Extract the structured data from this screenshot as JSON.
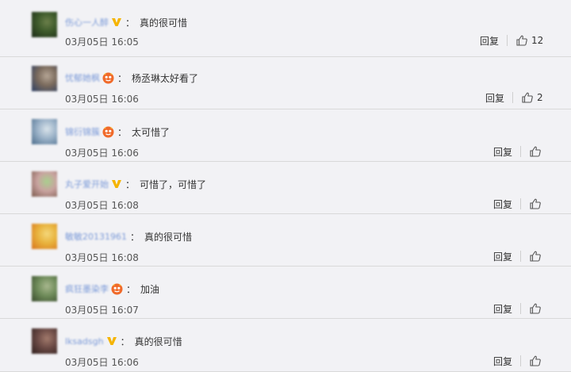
{
  "comments": [
    {
      "username": "伤心一人醉",
      "badge": "v-icon",
      "text": "真的很可惜",
      "time": "03月05日 16:05",
      "reply_label": "回复",
      "likes": "12",
      "avatar_colors": [
        "#3d5a2a",
        "#1c2b17",
        "#6b7f4a"
      ]
    },
    {
      "username": "忧郁她枫",
      "badge": "crown-icon",
      "text": "杨丞琳太好看了",
      "time": "03月05日 16:06",
      "reply_label": "回复",
      "likes": "2",
      "avatar_colors": [
        "#7a6a5c",
        "#2b3e63",
        "#b5a595"
      ]
    },
    {
      "username": "锦衍锦簇",
      "badge": "crown-icon",
      "text": "太可惜了",
      "time": "03月05日 16:06",
      "reply_label": "回复",
      "likes": "",
      "avatar_colors": [
        "#9bb2c8",
        "#4b6d8c",
        "#d9e3ea"
      ]
    },
    {
      "username": "丸子爱开始",
      "badge": "v-icon",
      "text": "可惜了，可惜了",
      "time": "03月05日 16:08",
      "reply_label": "回复",
      "likes": "",
      "avatar_colors": [
        "#c9a3a0",
        "#7d5b4e",
        "#a9cf8e"
      ]
    },
    {
      "username": "敏敏20131961",
      "badge": "",
      "text": "真的很可惜",
      "time": "03月05日 16:08",
      "reply_label": "回复",
      "likes": "",
      "avatar_colors": [
        "#e8b23c",
        "#d8741c",
        "#f4d77a"
      ]
    },
    {
      "username": "疯狂墨染李",
      "badge": "crown-icon",
      "text": "加油",
      "time": "03月05日 16:07",
      "reply_label": "回复",
      "likes": "",
      "avatar_colors": [
        "#6f8c5a",
        "#384a2b",
        "#a8b78e"
      ]
    },
    {
      "username": "lksadsgh",
      "badge": "v-icon",
      "text": "真的很可惜",
      "time": "03月05日 16:06",
      "reply_label": "回复",
      "likes": "",
      "avatar_colors": [
        "#6b4a45",
        "#2f1f1d",
        "#a27a6c"
      ]
    }
  ],
  "colors": {
    "username": "#7b9ad8",
    "v_badge": "#f5b400",
    "crown_badge": "#f06a2a",
    "divider": "#d9d9d9",
    "background": "#f2f2f5"
  }
}
